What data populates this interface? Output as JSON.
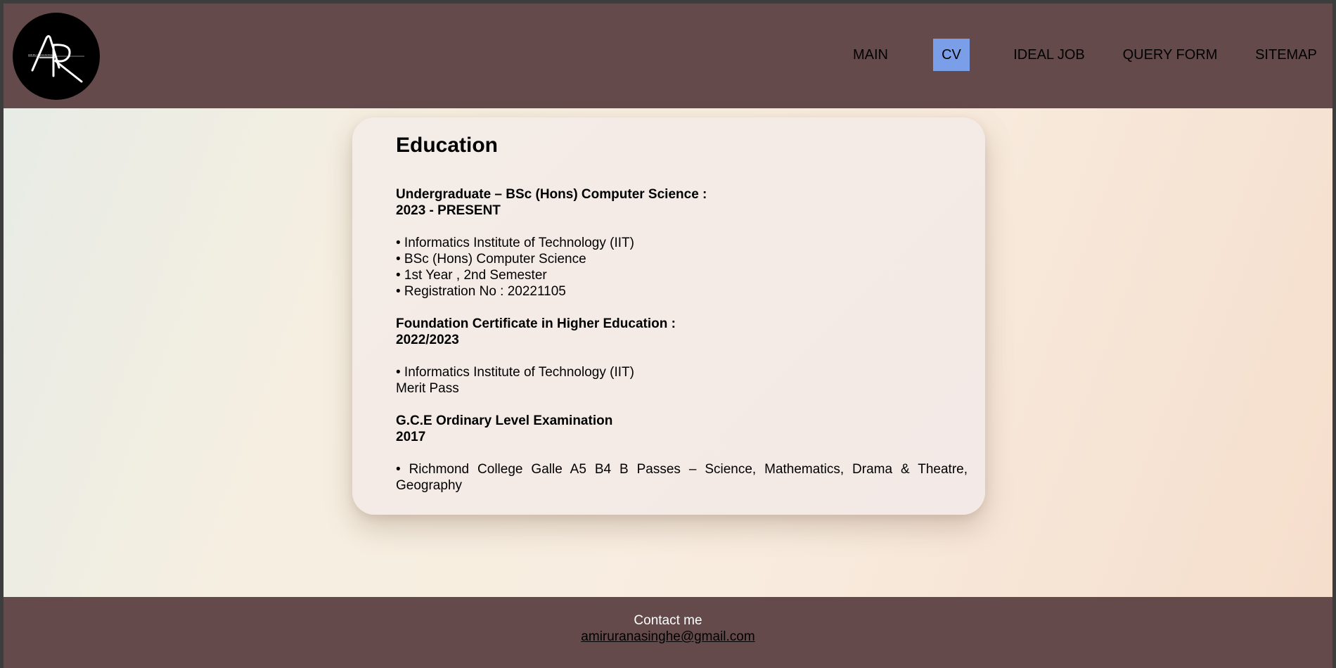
{
  "header": {
    "logo": {
      "text": "AR",
      "tagline": "AMIRU RANASINGHE",
      "icon": "ar-monogram-logo"
    },
    "nav": [
      {
        "label": "MAIN",
        "active": false
      },
      {
        "label": "CV",
        "active": true
      },
      {
        "label": "IDEAL JOB",
        "active": false
      },
      {
        "label": "QUERY FORM",
        "active": false
      },
      {
        "label": "SITEMAP",
        "active": false
      }
    ]
  },
  "education": {
    "title": "Education",
    "undergraduate": {
      "heading": "Undergraduate – BSc (Hons) Computer Science :",
      "period": "2023 - PRESENT",
      "items": [
        "• Informatics Institute of Technology (IIT)",
        "• BSc (Hons) Computer Science",
        "• 1st Year , 2nd Semester",
        "• Registration No : 20221105"
      ]
    },
    "foundation": {
      "heading": "Foundation Certificate in Higher Education :",
      "period": "2022/2023",
      "items": [
        "• Informatics Institute of Technology (IIT)",
        "Merit Pass"
      ]
    },
    "ol": {
      "heading": "G.C.E Ordinary Level Examination",
      "period": "2017",
      "items": [
        "• Richmond College Galle A5 B4 B Passes – Science, Mathematics, Drama & Theatre, Geography"
      ]
    }
  },
  "footer": {
    "contact_label": "Contact me",
    "email": "amiruranasinghe@gmail.com"
  },
  "colors": {
    "bar": "#644a4b",
    "active_nav": "#7b9ee8",
    "card": "#f4ece7"
  }
}
